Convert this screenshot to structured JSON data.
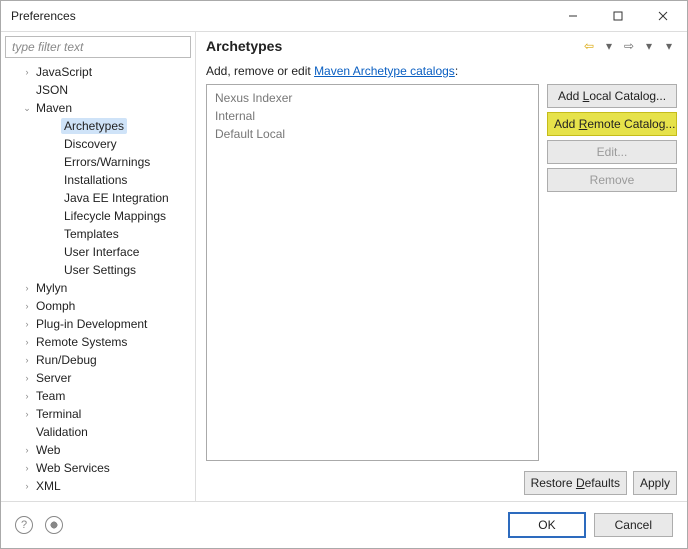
{
  "titlebar": {
    "title": "Preferences"
  },
  "filter_placeholder": "type filter text",
  "tree": [
    {
      "label": "JavaScript",
      "arrow": ">",
      "depth": 1
    },
    {
      "label": "JSON",
      "arrow": "",
      "depth": 1
    },
    {
      "label": "Maven",
      "arrow": "v",
      "depth": 1
    },
    {
      "label": "Archetypes",
      "arrow": "",
      "depth": 2,
      "selected": true
    },
    {
      "label": "Discovery",
      "arrow": "",
      "depth": 2
    },
    {
      "label": "Errors/Warnings",
      "arrow": "",
      "depth": 2
    },
    {
      "label": "Installations",
      "arrow": "",
      "depth": 2
    },
    {
      "label": "Java EE Integration",
      "arrow": "",
      "depth": 2
    },
    {
      "label": "Lifecycle Mappings",
      "arrow": "",
      "depth": 2
    },
    {
      "label": "Templates",
      "arrow": "",
      "depth": 2
    },
    {
      "label": "User Interface",
      "arrow": "",
      "depth": 2
    },
    {
      "label": "User Settings",
      "arrow": "",
      "depth": 2
    },
    {
      "label": "Mylyn",
      "arrow": ">",
      "depth": 1
    },
    {
      "label": "Oomph",
      "arrow": ">",
      "depth": 1
    },
    {
      "label": "Plug-in Development",
      "arrow": ">",
      "depth": 1
    },
    {
      "label": "Remote Systems",
      "arrow": ">",
      "depth": 1
    },
    {
      "label": "Run/Debug",
      "arrow": ">",
      "depth": 1
    },
    {
      "label": "Server",
      "arrow": ">",
      "depth": 1
    },
    {
      "label": "Team",
      "arrow": ">",
      "depth": 1
    },
    {
      "label": "Terminal",
      "arrow": ">",
      "depth": 1
    },
    {
      "label": "Validation",
      "arrow": "",
      "depth": 1
    },
    {
      "label": "Web",
      "arrow": ">",
      "depth": 1
    },
    {
      "label": "Web Services",
      "arrow": ">",
      "depth": 1
    },
    {
      "label": "XML",
      "arrow": ">",
      "depth": 1
    }
  ],
  "heading": "Archetypes",
  "instr_prefix": "Add, remove or edit ",
  "instr_link": "Maven Archetype catalogs",
  "instr_suffix": ":",
  "list_items": [
    "Nexus Indexer",
    "Internal",
    "Default Local"
  ],
  "buttons": {
    "add_local": "Add Local Catalog...",
    "add_remote": "Add Remote Catalog...",
    "edit": "Edit...",
    "remove": "Remove",
    "restore": "Restore Defaults",
    "apply": "Apply",
    "ok": "OK",
    "cancel": "Cancel"
  },
  "key_local": "L",
  "key_remote": "R",
  "key_restore": "D"
}
